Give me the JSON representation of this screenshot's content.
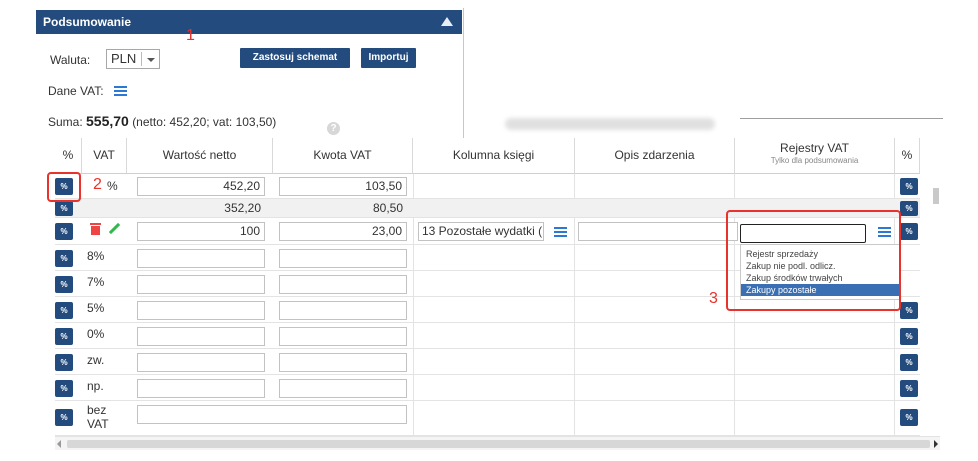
{
  "panel": {
    "title": "Podsumowanie",
    "currency_label": "Waluta:",
    "currency_value": "PLN",
    "apply_scheme_button": "Zastosuj schemat",
    "import_button": "Importuj",
    "vat_data_label": "Dane VAT:",
    "sum_prefix": "Suma: ",
    "sum_value": "555,70",
    "sum_detail": "(netto: 452,20; vat: 103,50)"
  },
  "grid": {
    "headers": {
      "pct": "%",
      "vat": "VAT",
      "net": "Wartość netto",
      "vat_amount": "Kwota VAT",
      "book_column": "Kolumna księgi",
      "event_desc": "Opis zdarzenia",
      "vat_registers": "Rejestry VAT",
      "vat_registers_sub": "Tylko dla podsumowania",
      "pct_right": "%"
    },
    "rows": [
      {
        "vat": "%",
        "net": "452,20",
        "vat_amount": "103,50"
      },
      {
        "vat": "",
        "net": "352,20",
        "vat_amount": "80,50"
      },
      {
        "vat": "",
        "net": "100",
        "vat_amount": "23,00",
        "book_column": "13 Pozostałe wydatki ( "
      },
      {
        "vat": "8%",
        "net": "",
        "vat_amount": ""
      },
      {
        "vat": "7%",
        "net": "",
        "vat_amount": ""
      },
      {
        "vat": "5%",
        "net": "",
        "vat_amount": ""
      },
      {
        "vat": "0%",
        "net": "",
        "vat_amount": ""
      },
      {
        "vat": "zw.",
        "net": "",
        "vat_amount": ""
      },
      {
        "vat": "np.",
        "net": "",
        "vat_amount": ""
      },
      {
        "vat_line1": "bez",
        "vat_line2": "VAT"
      }
    ],
    "percent_glyph": "%"
  },
  "dropdown": {
    "options": [
      "Rejestr sprzedaży",
      "Zakup nie podl. odlicz.",
      "Zakup środków trwałych",
      "Zakupy pozostałe"
    ],
    "selected_index": 3
  },
  "annotations": {
    "n1": "1",
    "n2": "2",
    "n3": "3"
  },
  "colors": {
    "primary": "#244b7d",
    "accent_icon": "#2b79d4",
    "annotation": "#e8322c"
  }
}
